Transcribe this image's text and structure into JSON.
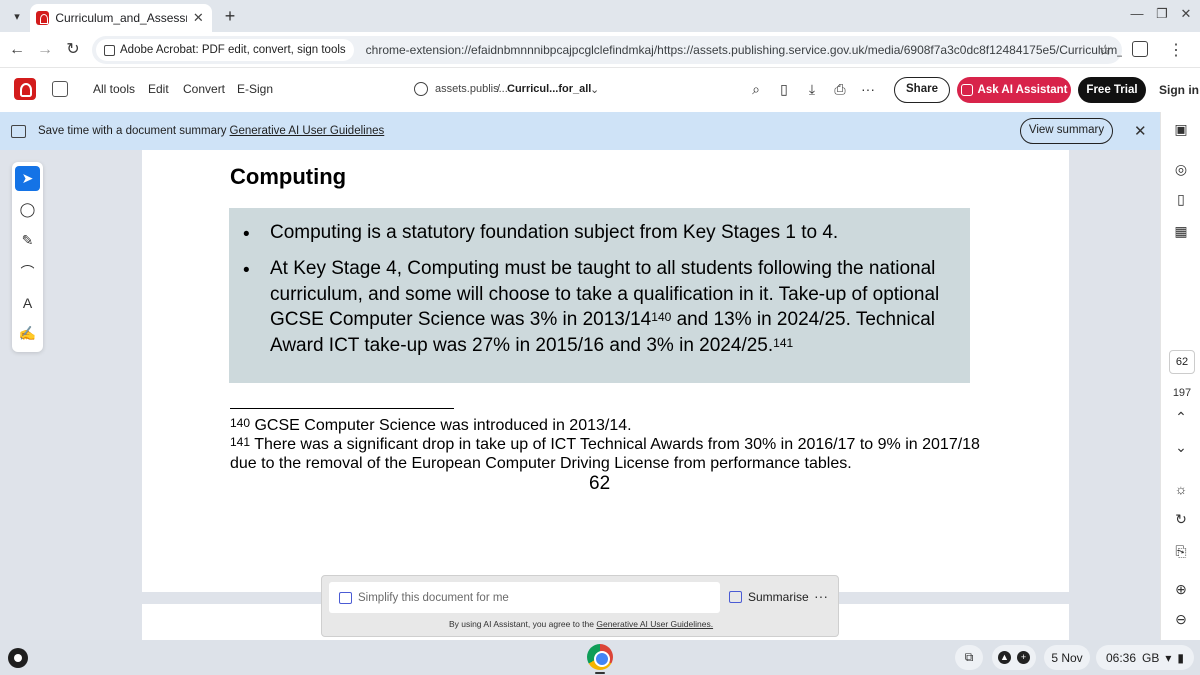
{
  "browser": {
    "tab_title": "Curriculum_and_Assessment_F",
    "tab_close": "✕",
    "new_tab": "+",
    "extension_chip": "Adobe Acrobat: PDF edit, convert, sign tools",
    "url": "chrome-extension://efaidnbmnnnibpcajpcglclefindmkaj/https://assets.publishing.service.gov.uk/media/6908f7a3c0dc8f12484175e5/Curriculum_and_Asses..."
  },
  "acrobat": {
    "menu": [
      "All tools",
      "Edit",
      "Convert",
      "E-Sign"
    ],
    "breadcrumb_host": "assets.publis...",
    "breadcrumb_sep": "/",
    "breadcrumb_file": "Curricul...for_all",
    "share": "Share",
    "ask_ai": "Ask AI Assistant",
    "free_trial": "Free Trial",
    "sign_in": "Sign in",
    "more": "···"
  },
  "banner": {
    "text": "Save time with a document summary",
    "link": "Generative AI User Guidelines",
    "button": "View summary",
    "close": "✕"
  },
  "document": {
    "heading": "Computing",
    "bullet_symbol": "•",
    "bullet1": "Computing is a statutory foundation subject from Key Stages 1 to 4.",
    "bullet2_part1": "At Key Stage 4, Computing must be taught to all students following the national curriculum, and some will choose to take a qualification in it. Take-up of optional GCSE Computer Science was 3% in 2013/14",
    "bullet2_sup1": "140",
    "bullet2_part2": " and 13% in 2024/25. Technical Award ICT take-up was 27% in 2015/16 and 3% in 2024/25.",
    "bullet2_sup2": "141",
    "footnote1_num": "140",
    "footnote1_text": " GCSE Computer Science was introduced in 2013/14.",
    "footnote2_num": "141",
    "footnote2_text": " There was a significant drop in take up of ICT Technical Awards from 30% in 2016/17 to 9% in 2017/18 due to the removal of the European Computer Driving License from performance tables.",
    "page_number": "62"
  },
  "navigation": {
    "current_page": "62",
    "total_pages": "197"
  },
  "ai_panel": {
    "placeholder": "Simplify this document for me",
    "summarise": "Summarise",
    "more": "···",
    "legal_prefix": "By using AI Assistant, you agree to the ",
    "legal_link": "Generative AI User Guidelines."
  },
  "shelf": {
    "date": "5 Nov",
    "time": "06:36",
    "locale": "GB"
  },
  "colors": {
    "accent_ai": "#d8234a",
    "banner": "#cfe3f7",
    "shaded_box": "#cdd9dc",
    "active_tool": "#1473e6"
  }
}
